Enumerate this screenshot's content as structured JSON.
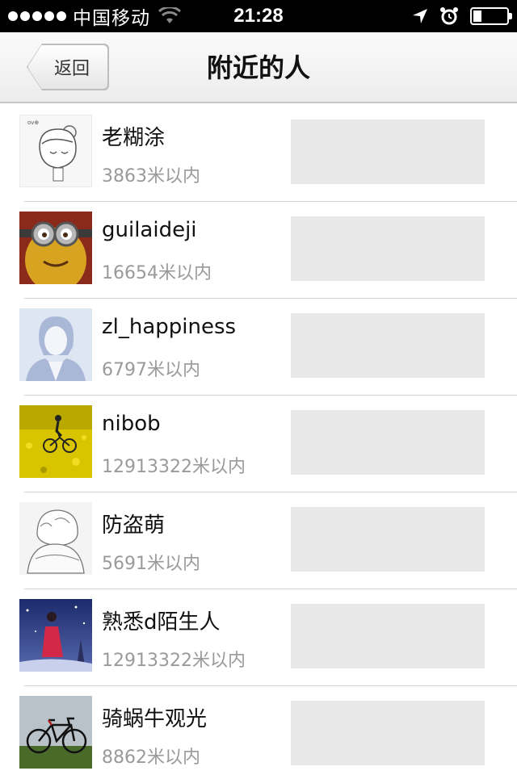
{
  "status_bar": {
    "carrier": "中国移动",
    "time": "21:28",
    "icons": [
      "signal-dots-icon",
      "wifi-icon",
      "location-arrow-icon",
      "alarm-icon",
      "battery-icon"
    ]
  },
  "nav": {
    "back_label": "返回",
    "title": "附近的人"
  },
  "users": [
    {
      "name": "老糊涂",
      "distance": "3863米以内",
      "avatar": "sketch-girl-avatar"
    },
    {
      "name": "guilaideji",
      "distance": "16654米以内",
      "avatar": "minion-avatar"
    },
    {
      "name": "zl_happiness",
      "distance": "6797米以内",
      "avatar": "default-person-avatar"
    },
    {
      "name": "nibob",
      "distance": "12913322米以内",
      "avatar": "cyclist-flowers-avatar"
    },
    {
      "name": "防盗萌",
      "distance": "5691米以内",
      "avatar": "sketch-sitting-avatar"
    },
    {
      "name": "熟悉d陌生人",
      "distance": "12913322米以内",
      "avatar": "night-girl-avatar"
    },
    {
      "name": "骑蜗牛观光",
      "distance": "8862米以内",
      "avatar": "bicycle-field-avatar"
    }
  ],
  "colors": {
    "status_bar_bg": "#000000",
    "nav_bg": "#f2f2f2",
    "name_text": "#111111",
    "distance_text": "#9a9a9a",
    "placeholder_box": "#e8e8e8"
  }
}
